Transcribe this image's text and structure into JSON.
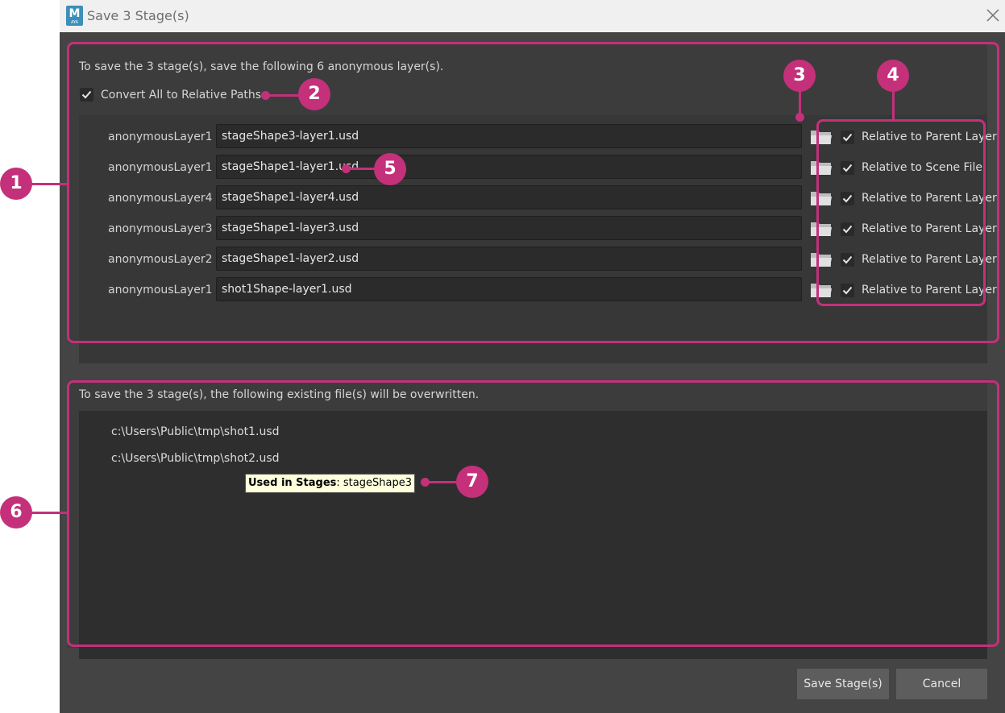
{
  "window": {
    "title": "Save 3 Stage(s)",
    "app_icon_letter": "M",
    "app_icon_sub": "AYA"
  },
  "anon_section": {
    "intro": "To save the 3 stage(s), save the following 6 anonymous layer(s).",
    "convert_all_label": "Convert All to Relative Paths",
    "convert_all_checked": true,
    "layers": [
      {
        "label": "anonymousLayer1",
        "path": "stageShape3-layer1.usd",
        "relative": "Relative to Parent Layer",
        "checked": true
      },
      {
        "label": "anonymousLayer1",
        "path": "stageShape1-layer1.usd",
        "relative": "Relative to Scene File",
        "checked": true
      },
      {
        "label": "anonymousLayer4",
        "path": "stageShape1-layer4.usd",
        "relative": "Relative to Parent Layer",
        "checked": true
      },
      {
        "label": "anonymousLayer3",
        "path": "stageShape1-layer3.usd",
        "relative": "Relative to Parent Layer",
        "checked": true
      },
      {
        "label": "anonymousLayer2",
        "path": "stageShape1-layer2.usd",
        "relative": "Relative to Parent Layer",
        "checked": true
      },
      {
        "label": "anonymousLayer1",
        "path": "shot1Shape-layer1.usd",
        "relative": "Relative to Parent Layer",
        "checked": true
      }
    ]
  },
  "files_section": {
    "intro": "To save the 3 stage(s), the following existing file(s) will be overwritten.",
    "files": [
      "c:\\Users\\Public\\tmp\\shot1.usd",
      "c:\\Users\\Public\\tmp\\shot2.usd"
    ],
    "tooltip_key": "Used in Stages",
    "tooltip_value": ": stageShape3"
  },
  "buttons": {
    "save": "Save Stage(s)",
    "cancel": "Cancel"
  },
  "callouts": [
    "1",
    "2",
    "3",
    "4",
    "5",
    "6",
    "7"
  ],
  "colors": {
    "accent": "#c4307a",
    "dialog_bg": "#444444",
    "tooltip_bg": "#ffffdc"
  }
}
